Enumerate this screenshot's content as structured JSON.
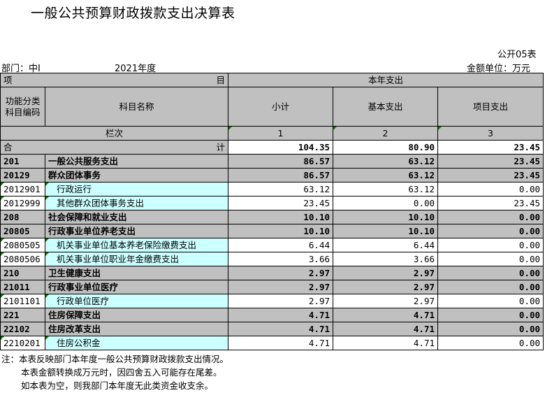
{
  "title": "一般公共预算财政拨款支出决算表",
  "table_id": "公开05表",
  "department_label": "部门：中I",
  "year": "2021年度",
  "unit": "金额单位：万元",
  "header": {
    "item": "项",
    "item_right": "目",
    "this_year": "本年支出",
    "code_col": "功能分类\n科目编码",
    "code_line1": "功能分类",
    "code_line2": "科目编码",
    "name_col": "科目名称",
    "subtotal": "小计",
    "basic": "基本支出",
    "project": "项目支出",
    "col_seq": "栏次",
    "seq1": "1",
    "seq2": "2",
    "seq3": "3",
    "total_left": "合",
    "total_right": "计"
  },
  "total": {
    "subtotal": "104.35",
    "basic": "80.90",
    "project": "23.45"
  },
  "rows": [
    {
      "code": "201",
      "name": "一般公共服务支出",
      "subtotal": "86.57",
      "basic": "63.12",
      "project": "23.45",
      "bold": true
    },
    {
      "code": "20129",
      "name": "群众团体事务",
      "subtotal": "86.57",
      "basic": "63.12",
      "project": "23.45",
      "bold": true
    },
    {
      "code": "2012901",
      "name": "行政运行",
      "subtotal": "63.12",
      "basic": "63.12",
      "project": "0.00",
      "bold": false
    },
    {
      "code": "2012999",
      "name": "其他群众团体事务支出",
      "subtotal": "23.45",
      "basic": "0.00",
      "project": "23.45",
      "bold": false
    },
    {
      "code": "208",
      "name": "社会保障和就业支出",
      "subtotal": "10.10",
      "basic": "10.10",
      "project": "0.00",
      "bold": true
    },
    {
      "code": "20805",
      "name": "行政事业单位养老支出",
      "subtotal": "10.10",
      "basic": "10.10",
      "project": "0.00",
      "bold": true
    },
    {
      "code": "2080505",
      "name": "机关事业单位基本养老保险缴费支出",
      "subtotal": "6.44",
      "basic": "6.44",
      "project": "0.00",
      "bold": false
    },
    {
      "code": "2080506",
      "name": "机关事业单位职业年金缴费支出",
      "subtotal": "3.66",
      "basic": "3.66",
      "project": "0.00",
      "bold": false
    },
    {
      "code": "210",
      "name": "卫生健康支出",
      "subtotal": "2.97",
      "basic": "2.97",
      "project": "0.00",
      "bold": true
    },
    {
      "code": "21011",
      "name": "行政事业单位医疗",
      "subtotal": "2.97",
      "basic": "2.97",
      "project": "0.00",
      "bold": true
    },
    {
      "code": "2101101",
      "name": "行政单位医疗",
      "subtotal": "2.97",
      "basic": "2.97",
      "project": "0.00",
      "bold": false
    },
    {
      "code": "221",
      "name": "住房保障支出",
      "subtotal": "4.71",
      "basic": "4.71",
      "project": "0.00",
      "bold": true
    },
    {
      "code": "22102",
      "name": "住房改革支出",
      "subtotal": "4.71",
      "basic": "4.71",
      "project": "0.00",
      "bold": true
    },
    {
      "code": "2210201",
      "name": "住房公积金",
      "subtotal": "4.71",
      "basic": "4.71",
      "project": "0.00",
      "bold": false
    }
  ],
  "notes": [
    "注：本表反映部门本年度一般公共预算财政拨款支出情况。",
    "本表金额转换成万元时，因四舍五入可能存在尾差。",
    "如本表为空，则我部门本年度无此类资金收支余。"
  ],
  "colors": {
    "header_gray": "#c0c0c0",
    "cyan_cell": "#ccffff",
    "marker_green": "#008000"
  }
}
